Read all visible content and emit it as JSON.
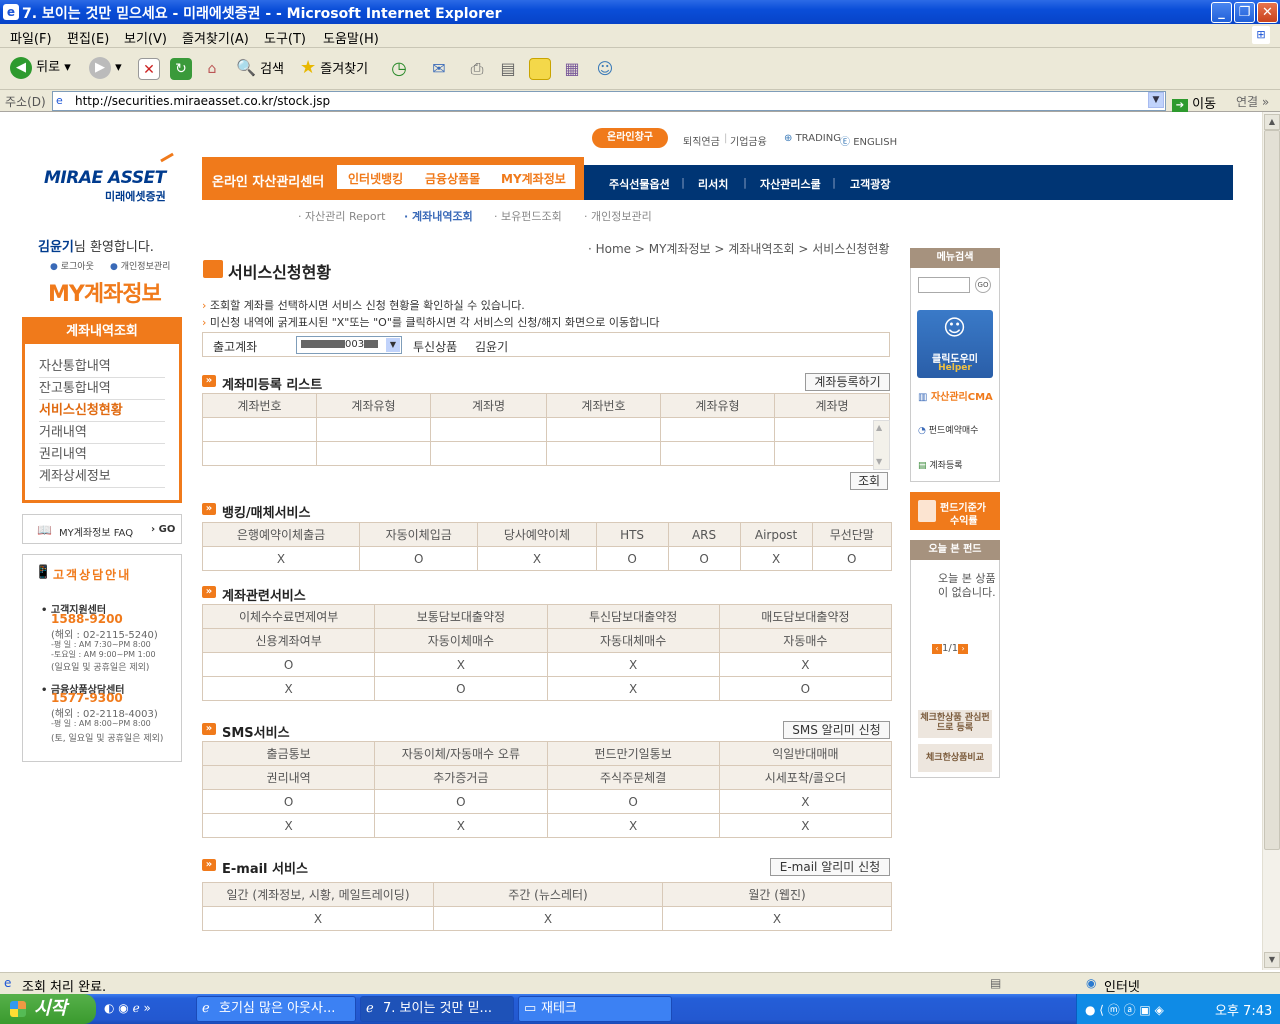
{
  "window": {
    "title": "7. 보이는 것만 믿으세요 - 미래에셋증권 - - Microsoft Internet Explorer"
  },
  "menu": [
    "파일(F)",
    "편집(E)",
    "보기(V)",
    "즐겨찾기(A)",
    "도구(T)",
    "도움말(H)"
  ],
  "toolbar": {
    "back": "뒤로",
    "search": "검색",
    "favorites": "즐겨찾기"
  },
  "address": {
    "label": "주소(D)",
    "url": "http://securities.miraeasset.co.kr/stock.jsp",
    "go": "이동",
    "links": "연결"
  },
  "status": {
    "text": "조회 처리 완료.",
    "zone": "인터넷"
  },
  "taskbar": {
    "start": "시작",
    "tasks": [
      "호기심 많은 아웃사...",
      "7. 보이는 것만 믿...",
      "재테크"
    ],
    "clock": "오후 7:43"
  },
  "header": {
    "logo_en": "MIRAE ASSET",
    "logo_kr": "미래에셋증권",
    "online_btn": "온라인창구",
    "top_links": [
      "퇴직연금",
      "기업금융",
      "TRADING",
      "ENGLISH"
    ],
    "center_title": "온라인 자산관리센터",
    "center_tabs": [
      "인터넷뱅킹",
      "금융상품몰",
      "MY계좌정보"
    ],
    "nav": [
      "주식선물옵션",
      "리서치",
      "자산관리스쿨",
      "고객광장"
    ],
    "subnav": [
      "자산관리 Report",
      "계좌내역조회",
      "보유펀드조회",
      "개인정보관리"
    ]
  },
  "sidebar": {
    "user": "김윤기",
    "welcome": "님 환영합니다.",
    "logout": "로그아웃",
    "privacy": "개인정보관리",
    "big_title": "MY계좌정보",
    "menu_header": "계좌내역조회",
    "items": [
      "자산통합내역",
      "잔고통합내역",
      "서비스신청현황",
      "거래내역",
      "권리내역",
      "계좌상세정보"
    ],
    "faq": "MY계좌정보 FAQ",
    "faq_go": "GO",
    "cs_title": "고객상담안내",
    "cs1_name": "고객지원센터",
    "cs1_phone": "1588-9200",
    "cs1_lines": [
      "(해외 : 02-2115-5240)",
      "-평   일 : AM 7:30~PM 8:00",
      "-토요일 : AM 9:00~PM 1:00",
      "(일요일 및 공휴일은 제외)"
    ],
    "cs2_name": "금융상품상담센터",
    "cs2_phone": "1577-9300",
    "cs2_lines": [
      "(해외 : 02-2118-4003)",
      "-평   일 : AM 8:00~PM 8:00",
      "(토, 일요일 및 공휴일은 제외)"
    ]
  },
  "breadcrumb": "· Home > MY계좌정보 > 계좌내역조회 > 서비스신청현황",
  "main": {
    "title": "서비스신청현황",
    "notes": [
      "조회할 계좌를 선택하시면 서비스 신청 현황을 확인하실 수 있습니다.",
      "미신청 내역에 굵게표시된 \"X\"또는 \"O\"를 클릭하시면 각 서비스의 신청/해지 화면으로 이동합니다"
    ],
    "account_label": "출고계좌",
    "account_value": "003",
    "account_type": "투신상품",
    "account_name": "김윤기",
    "unreg": {
      "title": "계좌미등록 리스트",
      "btn": "계좌등록하기",
      "headers": [
        "계좌번호",
        "계좌유형",
        "계좌명",
        "계좌번호",
        "계좌유형",
        "계좌명"
      ],
      "query_btn": "조회"
    },
    "banking": {
      "title": "뱅킹/매체서비스",
      "headers": [
        "은행예약이체출금",
        "자동이체입금",
        "당사예약이체",
        "HTS",
        "ARS",
        "Airpost",
        "무선단말"
      ],
      "values": [
        "X",
        "O",
        "X",
        "O",
        "O",
        "X",
        "O"
      ]
    },
    "account_svc": {
      "title": "계좌관련서비스",
      "headers1": [
        "이체수수료면제여부",
        "보통담보대출약정",
        "투신담보대출약정",
        "매도담보대출약정"
      ],
      "headers2": [
        "신용계좌여부",
        "자동이체매수",
        "자동대체매수",
        "자동매수"
      ],
      "row1": [
        "O",
        "X",
        "X",
        "X"
      ],
      "row2": [
        "X",
        "O",
        "X",
        "O"
      ]
    },
    "sms": {
      "title": "SMS서비스",
      "btn": "SMS 알리미 신청",
      "headers1": [
        "출금통보",
        "자동이체/자동매수 오류",
        "펀드만기일통보",
        "익일반대매매"
      ],
      "headers2": [
        "권리내역",
        "추가증거금",
        "주식주문체결",
        "시세포착/콜오더"
      ],
      "row1": [
        "O",
        "O",
        "O",
        "X"
      ],
      "row2": [
        "X",
        "X",
        "X",
        "X"
      ]
    },
    "email": {
      "title": "E-mail 서비스",
      "btn": "E-mail 알리미 신청",
      "headers": [
        "일간 (계좌정보, 시황, 메일트레이딩)",
        "주간 (뉴스레터)",
        "월간 (웹진)"
      ],
      "values": [
        "X",
        "X",
        "X"
      ]
    }
  },
  "right": {
    "menu_search": "메뉴검색",
    "go": "GO",
    "helper_kr": "클릭도우미",
    "helper_en": "Helper",
    "links": [
      "자산관리CMA",
      "펀드예약매수",
      "계좌등록"
    ],
    "fund_banner": [
      "펀드기준가",
      "수익률"
    ],
    "today_title": "오늘 본 펀드",
    "today_empty": "오늘 본 상품이 없습니다.",
    "paging": "1/1",
    "check_btn1": "체크한상품 관심펀드로 등록",
    "check_btn2": "체크한상품비교"
  }
}
